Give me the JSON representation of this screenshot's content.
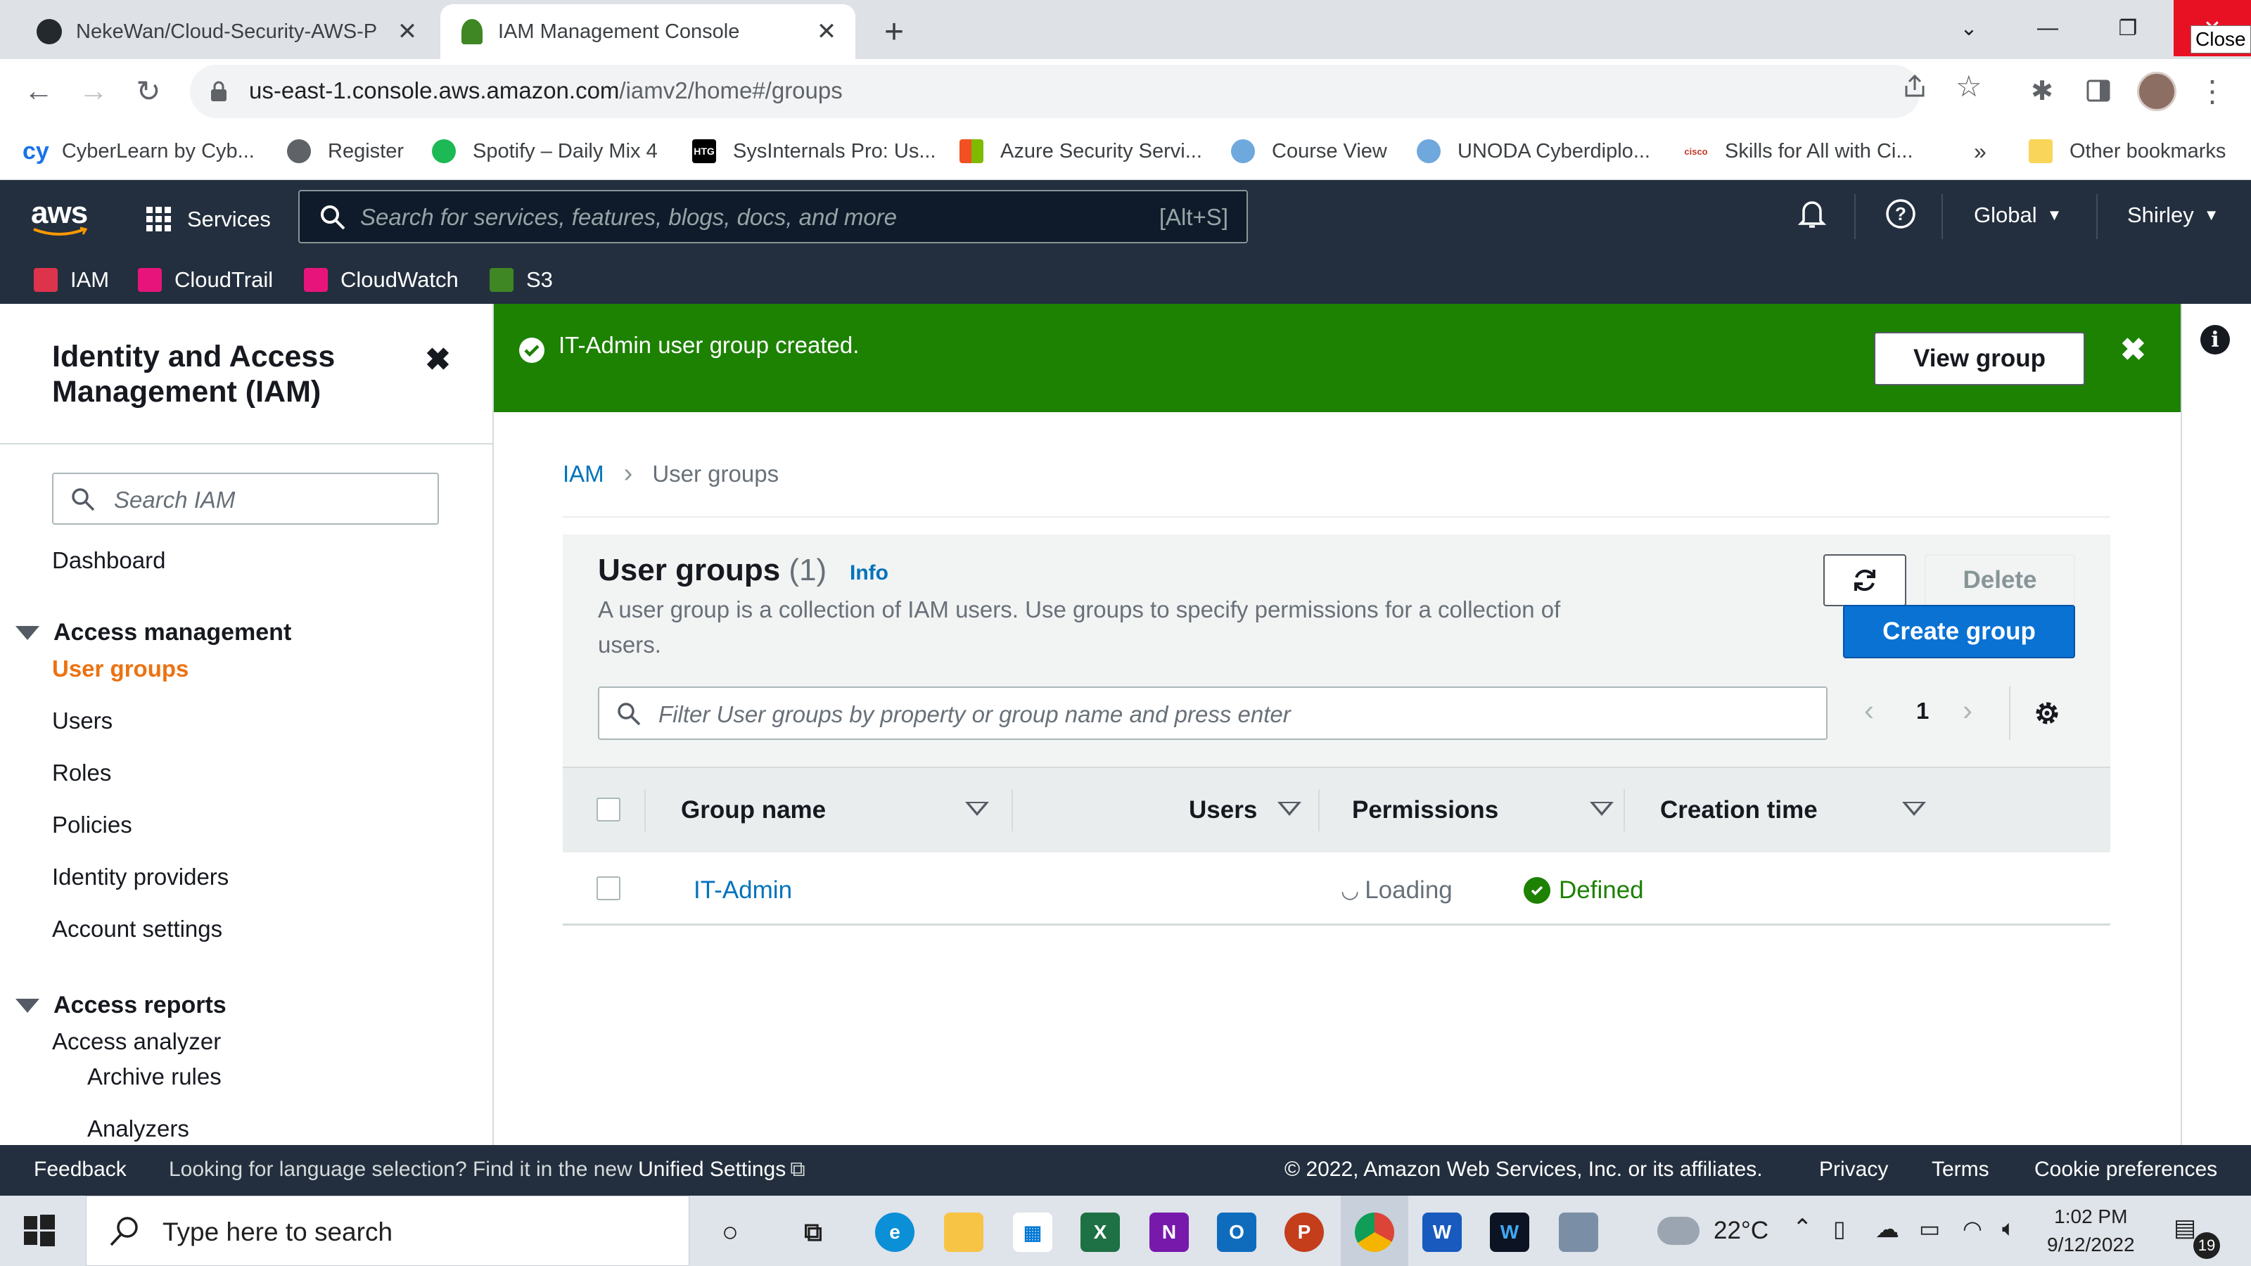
{
  "browser": {
    "tabs": [
      {
        "title": "NekeWan/Cloud-Security-AWS-P",
        "icon": "github-icon"
      },
      {
        "title": "IAM Management Console",
        "icon": "aws-tab-icon",
        "active": true
      }
    ],
    "close_tooltip": "Close",
    "url_host": "us-east-1.console.aws.amazon.com",
    "url_path": "/iamv2/home#/groups",
    "bookmarks": [
      {
        "label": "CyberLearn by Cyb...",
        "color": "#1a73e8",
        "glyph": "cy"
      },
      {
        "label": "Register",
        "color": "#5f6368",
        "glyph": ""
      },
      {
        "label": "Spotify – Daily Mix 4",
        "color": "#1db954",
        "glyph": ""
      },
      {
        "label": "SysInternals Pro: Us...",
        "color": "#000000",
        "glyph": "HTG"
      },
      {
        "label": "Azure Security Servi...",
        "color": "#f25022",
        "glyph": ""
      },
      {
        "label": "Course View",
        "color": "#6fa8dc",
        "glyph": ""
      },
      {
        "label": "UNODA Cyberdiplo...",
        "color": "#6fa8dc",
        "glyph": ""
      },
      {
        "label": "Skills for All with Ci...",
        "color": "#c0392b",
        "glyph": "cisco"
      }
    ],
    "bookmarks_more": "»",
    "other_bookmarks": "Other bookmarks"
  },
  "aws_nav": {
    "logo": "aws",
    "services": "Services",
    "search_placeholder": "Search for services, features, blogs, docs, and more",
    "search_shortcut": "[Alt+S]",
    "region": "Global",
    "user": "Shirley",
    "favorites": [
      {
        "label": "IAM",
        "color": "#dd344c"
      },
      {
        "label": "CloudTrail",
        "color": "#e7157b"
      },
      {
        "label": "CloudWatch",
        "color": "#e7157b"
      },
      {
        "label": "S3",
        "color": "#3f8624"
      }
    ]
  },
  "sidebar": {
    "title": "Identity and Access Management (IAM)",
    "search_placeholder": "Search IAM",
    "dashboard": "Dashboard",
    "section_access_management": "Access management",
    "items": [
      "User groups",
      "Users",
      "Roles",
      "Policies",
      "Identity providers",
      "Account settings"
    ],
    "active_item": "User groups",
    "section_access_reports": "Access reports",
    "access_analyzer": "Access analyzer",
    "archive_rules": "Archive rules",
    "analyzers": "Analyzers"
  },
  "flash": {
    "message": "IT-Admin user group created.",
    "button": "View group"
  },
  "breadcrumb": {
    "root": "IAM",
    "current": "User groups"
  },
  "panel": {
    "title": "User groups",
    "count": "(1)",
    "info": "Info",
    "description": "A user group is a collection of IAM users. Use groups to specify permissions for a collection of users.",
    "delete": "Delete",
    "create": "Create group",
    "filter_placeholder": "Filter User groups by property or group name and press enter",
    "page": "1"
  },
  "table": {
    "columns": [
      "Group name",
      "Users",
      "Permissions",
      "Creation time"
    ],
    "rows": [
      {
        "group_name": "IT-Admin",
        "users": "Loading",
        "permissions": "Defined",
        "creation_time": ""
      }
    ]
  },
  "footer": {
    "feedback": "Feedback",
    "language_text": "Looking for language selection? Find it in the new",
    "unified_settings": "Unified Settings",
    "copyright": "© 2022, Amazon Web Services, Inc. or its affiliates.",
    "privacy": "Privacy",
    "terms": "Terms",
    "cookies": "Cookie preferences"
  },
  "taskbar": {
    "search_placeholder": "Type here to search",
    "temperature": "22°C",
    "time": "1:02 PM",
    "date": "9/12/2022",
    "notifications": "19"
  }
}
